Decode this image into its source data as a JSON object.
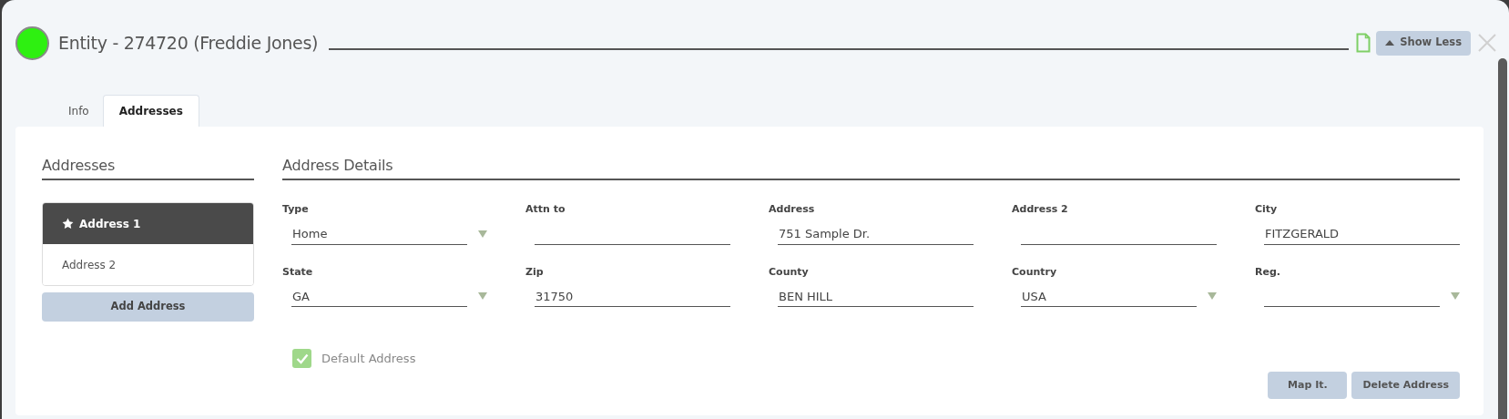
{
  "window": {
    "title": "Entity - 274720 (Freddie Jones)"
  },
  "header_buttons": {
    "show_less": "Show Less"
  },
  "tabs": [
    {
      "label": "Info",
      "selected": false
    },
    {
      "label": "Addresses",
      "selected": true
    }
  ],
  "addresses": {
    "heading": "Addresses",
    "items": [
      {
        "label": "Address 1",
        "selected": true,
        "starred": true
      },
      {
        "label": "Address 2",
        "selected": false,
        "starred": false
      }
    ],
    "add_button": "Add Address"
  },
  "details": {
    "heading": "Address Details",
    "fields": [
      {
        "label": "Type",
        "value": "Home",
        "kind": "select"
      },
      {
        "label": "Attn to",
        "kind": "text"
      },
      {
        "label": "Address",
        "value": "751 Sample Dr.",
        "kind": "text"
      },
      {
        "label": "Address 2",
        "kind": "text"
      },
      {
        "label": "City",
        "value": "FITZGERALD",
        "kind": "text"
      },
      {
        "label": "State",
        "value": "GA",
        "kind": "select"
      },
      {
        "label": "Zip",
        "value": "31750",
        "kind": "text"
      },
      {
        "label": "County",
        "value": "BEN HILL",
        "kind": "text"
      },
      {
        "label": "Country",
        "value": "USA",
        "kind": "select"
      },
      {
        "label": "Reg.",
        "kind": "select"
      }
    ],
    "default_address": {
      "label": "Default Address",
      "checked": true
    },
    "buttons": [
      "Map It.",
      "Delete Address"
    ]
  }
}
